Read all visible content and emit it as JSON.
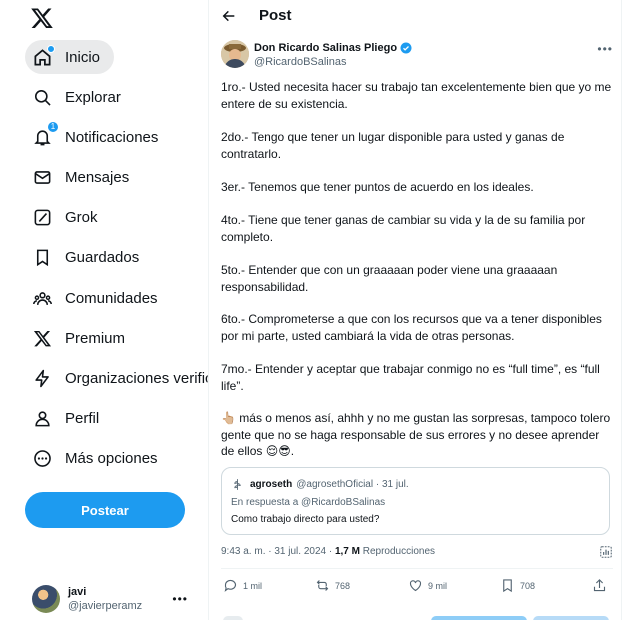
{
  "sidebar": {
    "logo": "x-logo-icon",
    "items": [
      {
        "label": "Inicio",
        "icon": "home-icon",
        "active": true
      },
      {
        "label": "Explorar",
        "icon": "search-icon"
      },
      {
        "label": "Notificaciones",
        "icon": "bell-icon",
        "badge": "1"
      },
      {
        "label": "Mensajes",
        "icon": "mail-icon"
      },
      {
        "label": "Grok",
        "icon": "grok-icon"
      },
      {
        "label": "Guardados",
        "icon": "bookmark-icon"
      },
      {
        "label": "Comunidades",
        "icon": "communities-icon"
      },
      {
        "label": "Premium",
        "icon": "x-premium-icon"
      },
      {
        "label": "Organizaciones verificadas",
        "icon": "lightning-icon"
      },
      {
        "label": "Perfil",
        "icon": "profile-icon"
      },
      {
        "label": "Más opciones",
        "icon": "more-circle-icon"
      }
    ],
    "post_button": "Postear",
    "account": {
      "name": "javi",
      "handle": "@javierperamz"
    }
  },
  "header": {
    "title": "Post"
  },
  "post": {
    "author_name": "Don Ricardo Salinas Pliego",
    "author_handle": "@RicardoBSalinas",
    "paragraphs": [
      "1ro.- Usted necesita hacer su trabajo tan excelentemente bien que yo me entere de su existencia.",
      "2do.- Tengo que tener un lugar disponible para usted y ganas de contratarlo.",
      "3er.- Tenemos que tener puntos de acuerdo en los ideales.",
      "4to.- Tiene que tener ganas de cambiar su vida y la de su familia por completo.",
      "5to.- Entender que con un graaaaan poder viene una graaaaan responsabilidad.",
      "6to.- Comprometerse a que con los recursos que va a tener disponibles por mi parte, usted cambiará la vida de otras personas.",
      "7mo.- Entender y aceptar que trabajar conmigo no es “full time”, es “full life”.",
      "👆🏼 más o menos así, ahhh y no me gustan las sorpresas, tampoco tolero gente que no se haga responsable de sus errores y no desee aprender de ellos 😌😎."
    ],
    "quote": {
      "name": "agroseth",
      "handle": "@agrosethOficial · 31 jul.",
      "reply_prefix": "En respuesta a ",
      "reply_to": "@RicardoBSalinas",
      "text": "Como trabajo directo para usted?"
    },
    "time": "9:43 a. m. · 31 jul. 2024 · ",
    "views": "1,7 M",
    "views_label": " Reproducciones",
    "actions": {
      "replies": "1 mil",
      "reposts": "768",
      "likes": "9 mil",
      "bookmarks": "708"
    }
  },
  "colors": {
    "accent": "#1d9bf0",
    "text": "#0f1419",
    "muted": "#536471"
  }
}
